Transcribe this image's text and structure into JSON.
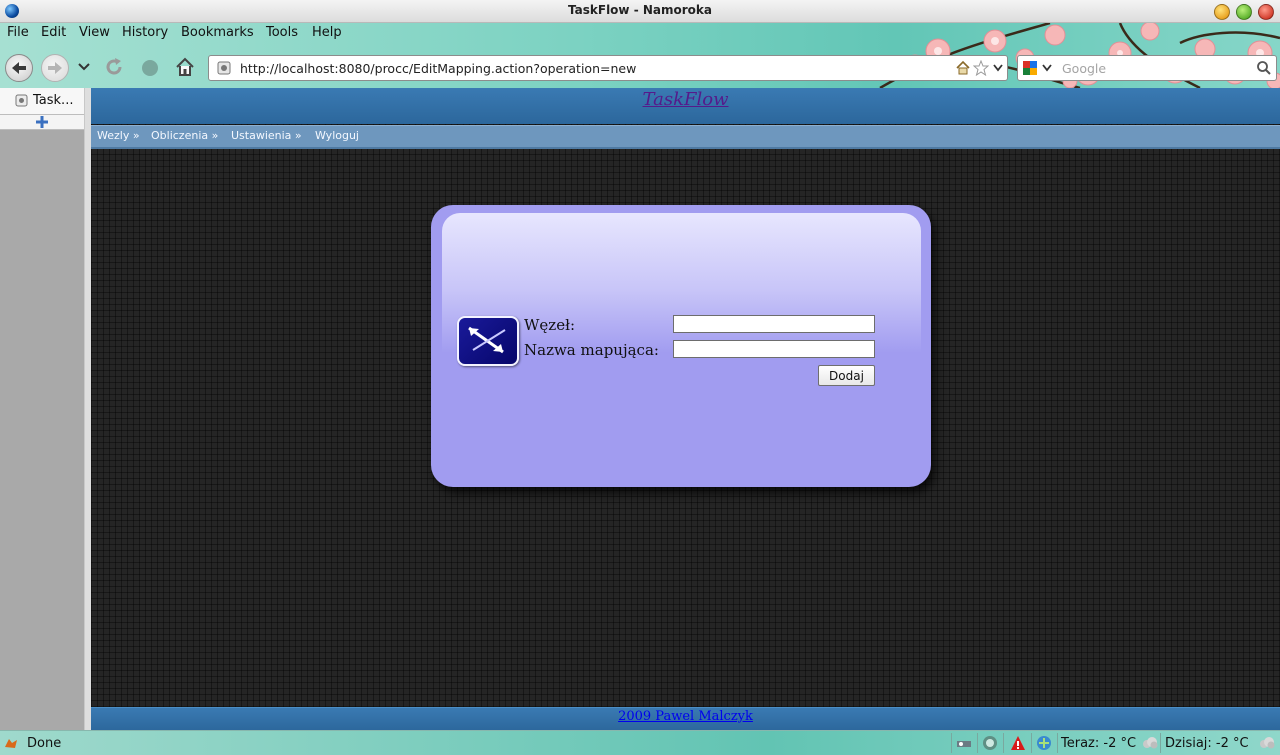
{
  "window": {
    "title": "TaskFlow - Namoroka"
  },
  "menu": [
    "File",
    "Edit",
    "View",
    "History",
    "Bookmarks",
    "Tools",
    "Help"
  ],
  "navbar": {
    "url": "http://localhost:8080/procc/EditMapping.action?operation=new",
    "search_placeholder": "Google"
  },
  "tabs": [
    {
      "label": "Task..."
    }
  ],
  "page": {
    "site_title": "TaskFlow",
    "nav_links": [
      "Wezly »",
      "Obliczenia »",
      "Ustawienia »",
      "Wyloguj"
    ],
    "form": {
      "node_label": "Węzeł:",
      "node_value": "",
      "mapping_label": "Nazwa mapująca:",
      "mapping_value": "",
      "submit_label": "Dodaj"
    },
    "footer_link": "2009 Pawel Malczyk"
  },
  "statusbar": {
    "status_text": "Done",
    "weather_now": "Teraz: -2 °C",
    "weather_today": "Dzisiaj: -2 °C"
  },
  "colors": {
    "page_header": "#2f6da3",
    "nav_strip": "#6e97be",
    "login_box": "#a19cf0",
    "link": "#551a8b"
  }
}
